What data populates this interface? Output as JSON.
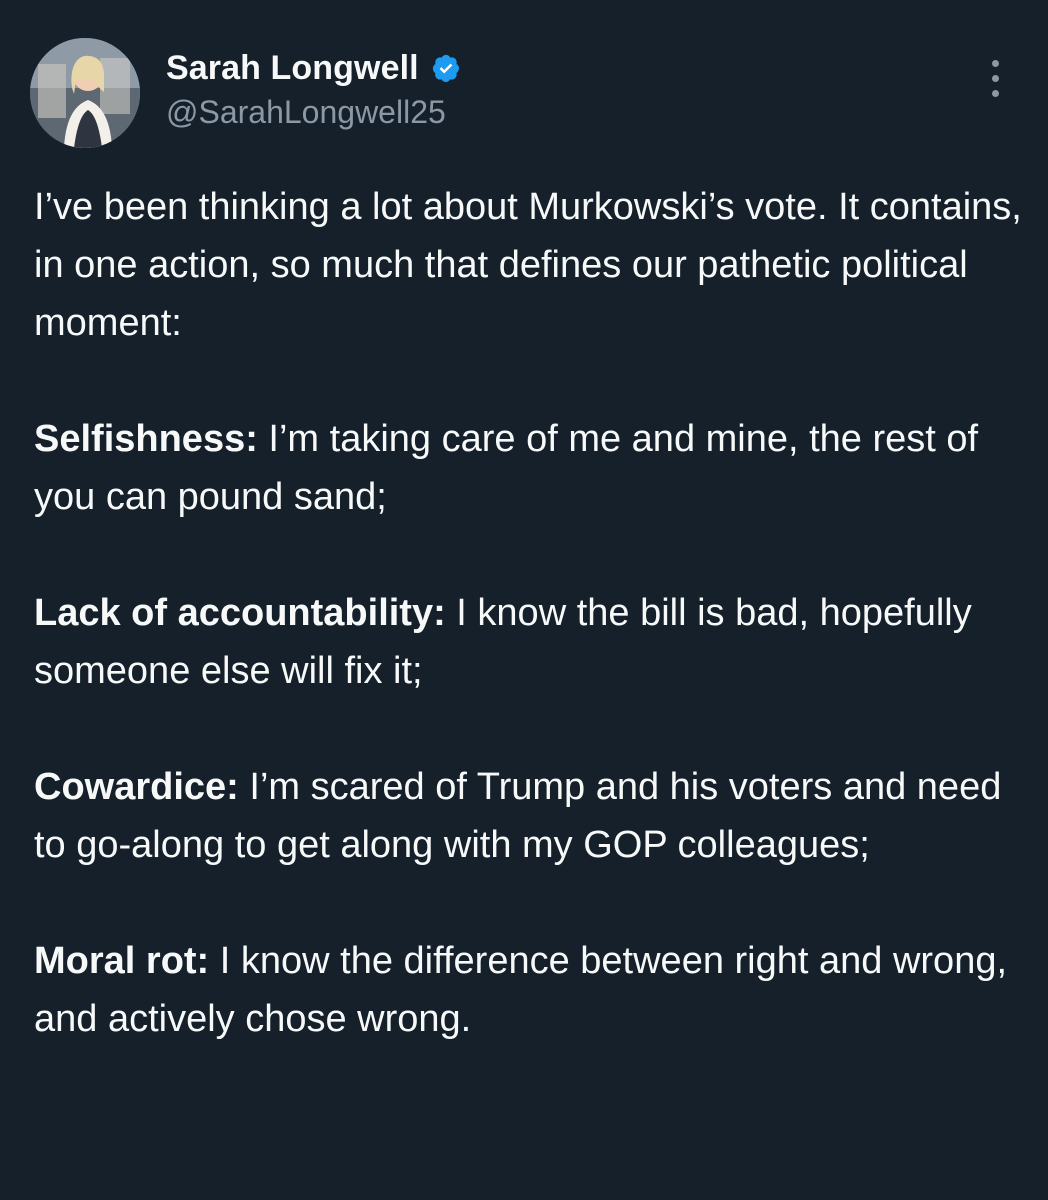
{
  "author": {
    "display_name": "Sarah Longwell",
    "handle": "@SarahLongwell25",
    "verified_icon": "verified-badge-icon",
    "avatar_icon": "profile-photo"
  },
  "menu_icon": "more-options-icon",
  "colors": {
    "background": "#15202b",
    "text": "#f7f9f9",
    "secondary": "#8b98a5",
    "verified": "#1d9bf0"
  },
  "tweet": {
    "intro": "I’ve been thinking a lot about Murkowski’s vote. It contains, in one action, so much that defines our pathetic political moment:",
    "points": [
      {
        "term": "Selfishness:",
        "text": " I’m taking care of me and mine, the rest of you can pound sand;"
      },
      {
        "term": "Lack of accountability:",
        "text": " I know the bill is bad, hopefully someone else will fix it;"
      },
      {
        "term": "Cowardice:",
        "text": " I’m scared of Trump and his voters and need to go-along to get along with my GOP colleagues;"
      },
      {
        "term": "Moral rot:",
        "text": " I know the difference between right and wrong, and actively chose wrong."
      }
    ]
  }
}
